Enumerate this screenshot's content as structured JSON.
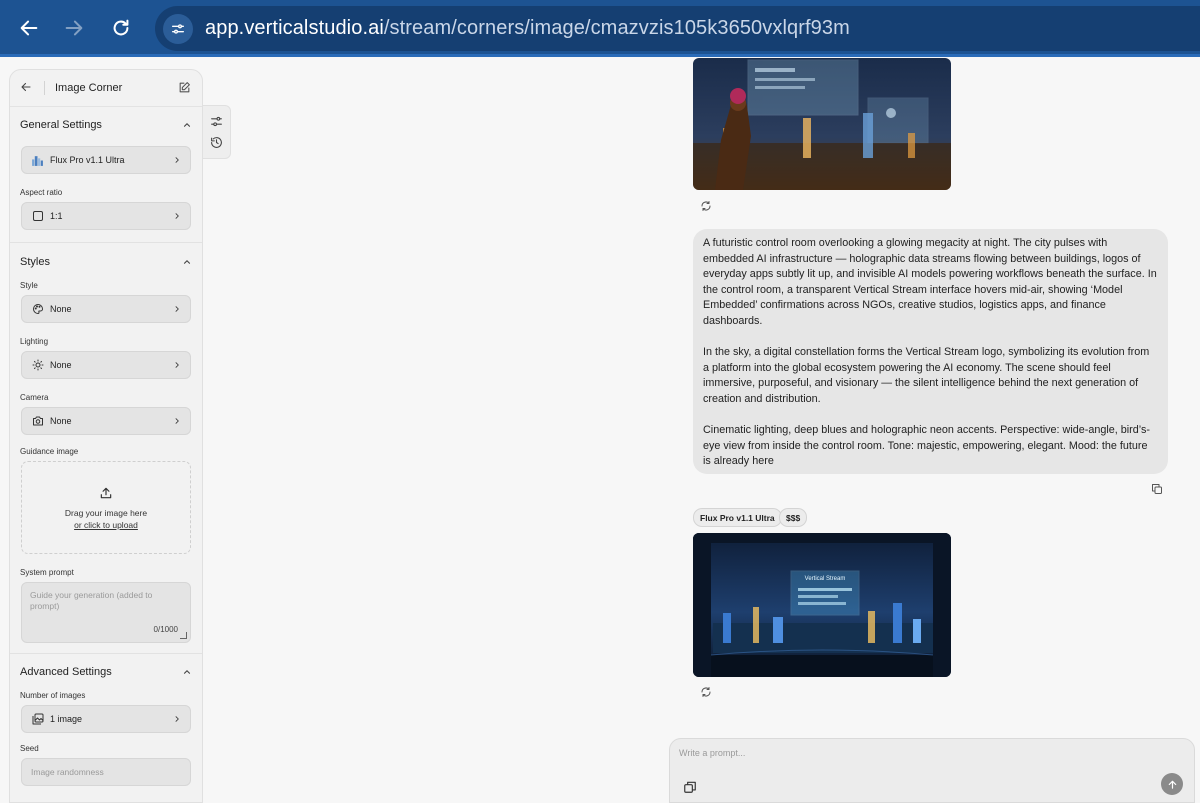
{
  "browser": {
    "url_host": "app.verticalstudio.ai",
    "url_path": "/stream/corners/image/cmazvzis105k3650vxlqrf93m"
  },
  "sidebar": {
    "title": "Image Corner",
    "general": {
      "heading": "General Settings",
      "model": "Flux Pro v1.1 Ultra",
      "aspect_label": "Aspect ratio",
      "aspect_value": "1:1"
    },
    "styles": {
      "heading": "Styles",
      "style_label": "Style",
      "style_value": "None",
      "lighting_label": "Lighting",
      "lighting_value": "None",
      "camera_label": "Camera",
      "camera_value": "None",
      "guidance_label": "Guidance image",
      "upload_text": "Drag your image here",
      "upload_link": "or click to upload",
      "system_prompt_label": "System prompt",
      "system_prompt_placeholder": "Guide your generation (added to prompt)",
      "system_prompt_count": "0/1000"
    },
    "advanced": {
      "heading": "Advanced Settings",
      "num_images_label": "Number of images",
      "num_images_value": "1 image",
      "seed_label": "Seed",
      "seed_placeholder": "Image randomness"
    }
  },
  "chat": {
    "message_paragraphs": [
      "A futuristic control room overlooking a glowing megacity at night. The city pulses with embedded AI infrastructure — holographic data streams flowing between buildings, logos of everyday apps subtly lit up, and invisible AI models powering workflows beneath the surface. In the control room, a transparent Vertical Stream interface hovers mid-air, showing ‘Model Embedded’ confirmations across NGOs, creative studios, logistics apps, and finance dashboards.",
      "In the sky, a digital constellation forms the Vertical Stream logo, symbolizing its evolution from a platform into the global ecosystem powering the AI economy. The scene should feel immersive, purposeful, and visionary — the silent intelligence behind the next generation of creation and distribution.",
      "Cinematic lighting, deep blues and holographic neon accents. Perspective: wide-angle, bird’s-eye view from inside the control room. Tone: majestic, empowering, elegant. Mood: the future is already here"
    ],
    "model_chip": "Flux Pro v1.1 Ultra",
    "cost_chip": "$$$",
    "image2_screen_text": "Vertical Stream"
  },
  "prompt": {
    "placeholder": "Write a prompt..."
  }
}
